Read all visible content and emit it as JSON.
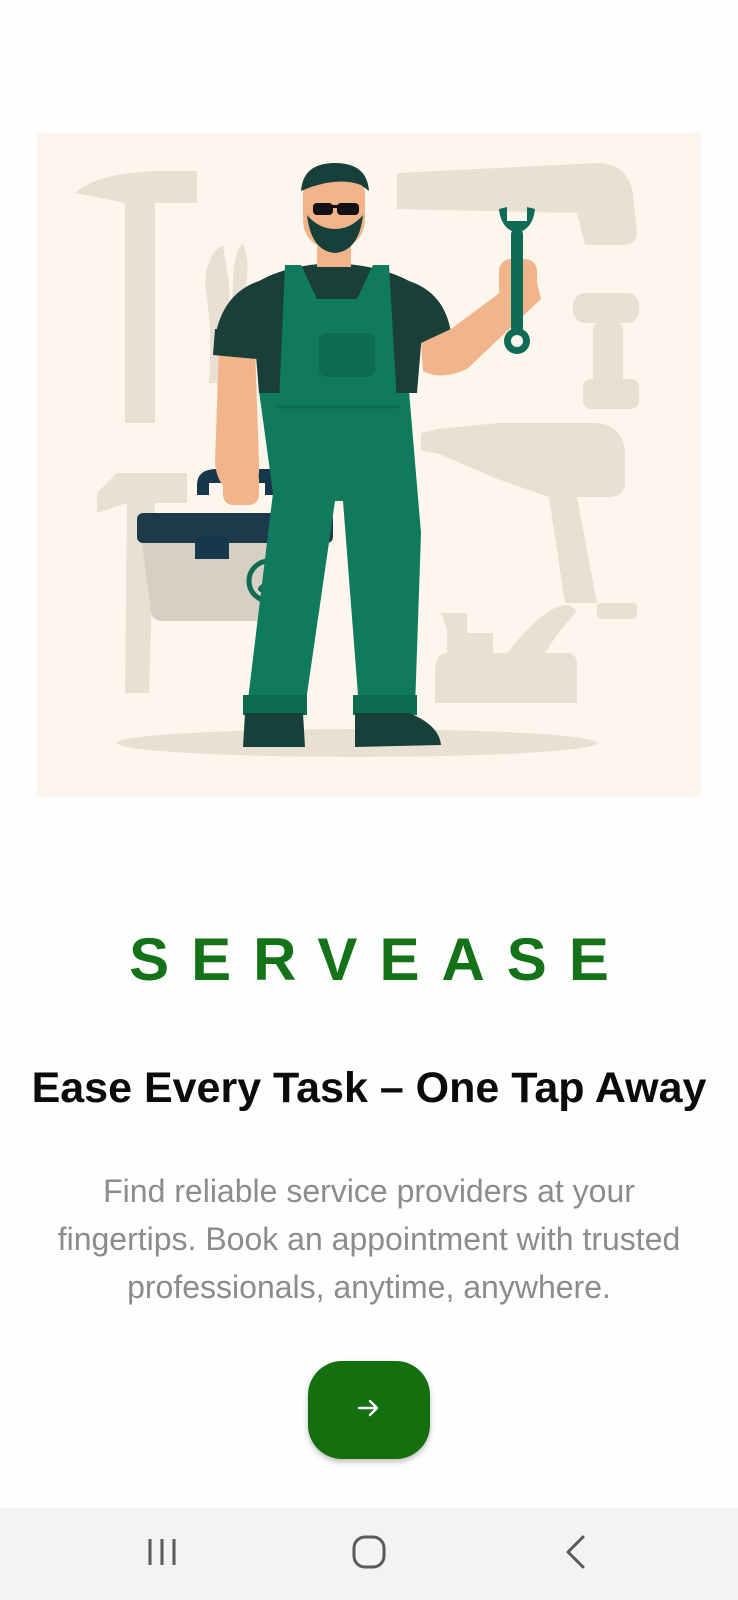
{
  "app": {
    "brand": "SERVEASE",
    "headline": "Ease Every Task – One Tap Away",
    "description": "Find reliable service providers at your fingertips. Book an appointment with trusted professionals, anytime, anywhere."
  },
  "hero": {
    "icon": "worker-illustration",
    "background_color": "#fcf6ec"
  },
  "next_button": {
    "icon": "arrow-right-icon",
    "color": "#14700f"
  },
  "system_nav": {
    "recents_icon": "recents-icon",
    "home_icon": "home-icon",
    "back_icon": "back-icon"
  },
  "colors": {
    "brand_green": "#147318",
    "headline": "#0b0b0b",
    "description": "#8c8c8c",
    "overall_green": "#0f7a5c"
  }
}
